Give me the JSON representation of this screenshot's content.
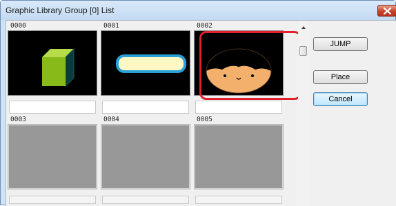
{
  "window": {
    "title": "Graphic Library Group [0] List"
  },
  "tiles": [
    {
      "number": "0000",
      "graphic": "green-cube"
    },
    {
      "number": "0001",
      "graphic": "yellow-rounded-bar"
    },
    {
      "number": "0002",
      "graphic": "cartoon-face",
      "highlighted": true
    },
    {
      "number": "0003",
      "graphic": "empty"
    },
    {
      "number": "0004",
      "graphic": "empty"
    },
    {
      "number": "0005",
      "graphic": "empty"
    }
  ],
  "buttons": {
    "jump": "JUMP",
    "place": "Place",
    "cancel": "Cancel"
  },
  "colors": {
    "highlight": "#e0202a",
    "cube_front": "#88bb1a",
    "cube_top": "#b7dc4a",
    "cube_side": "#0b3b3a",
    "bar_fill": "#fff7c4",
    "bar_border": "#2aa0d8",
    "face_skin": "#f2b06c",
    "empty_thumb": "#989898"
  }
}
